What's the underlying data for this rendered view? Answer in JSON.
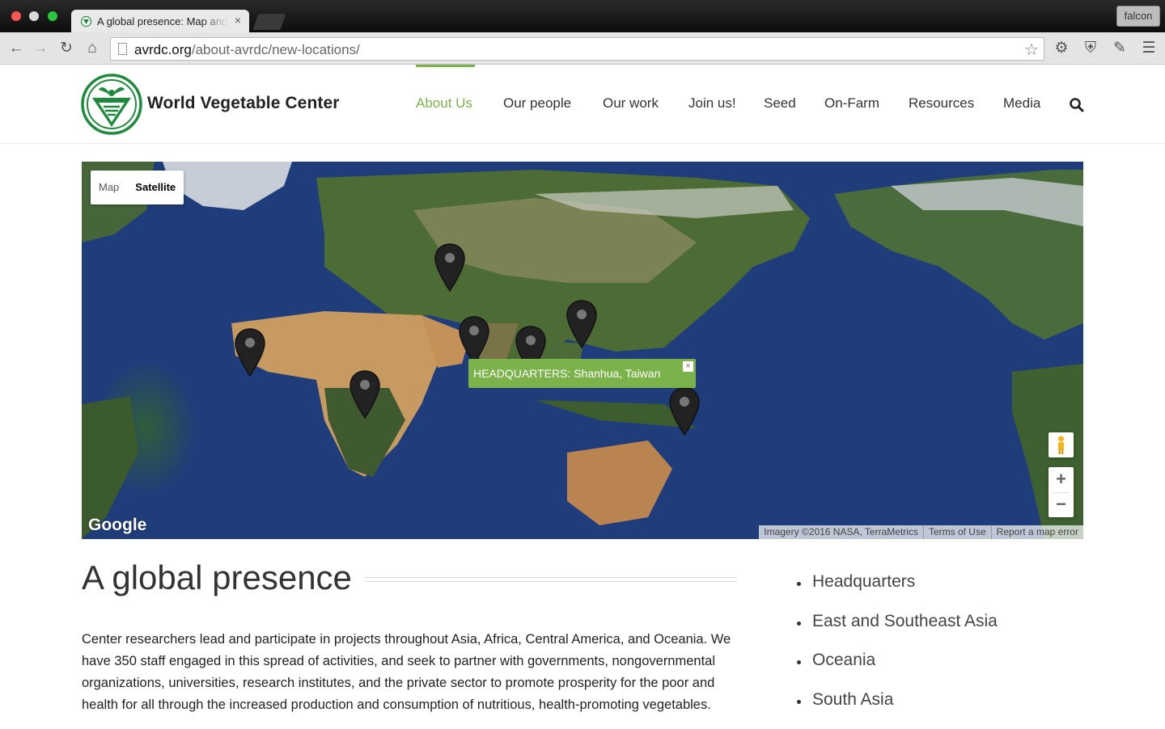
{
  "browser": {
    "tab_title": "A global presence: Map and",
    "tab_close": "×",
    "profile": "falcon",
    "url_host": "avrdc.org",
    "url_path": "/about-avrdc/new-locations/"
  },
  "site": {
    "logo_text": "World Vegetable Center",
    "nav": [
      {
        "label": "About Us",
        "active": true
      },
      {
        "label": "Our people"
      },
      {
        "label": "Our work"
      },
      {
        "label": "Join us!"
      },
      {
        "label": "Seed"
      },
      {
        "label": "On-Farm"
      },
      {
        "label": "Resources"
      },
      {
        "label": "Media"
      }
    ],
    "accent_color": "#7bb34a"
  },
  "map": {
    "type_map": "Map",
    "type_satellite": "Satellite",
    "selected_type": "Satellite",
    "infowindow": "HEADQUARTERS: Shanhua, Taiwan",
    "infowindow_close": "×",
    "zoom_in": "+",
    "zoom_out": "−",
    "logo": "Google",
    "attribution": {
      "imagery": "Imagery ©2016 NASA, TerraMetrics",
      "terms": "Terms of Use",
      "report": "Report a map error"
    },
    "marker_count": 8
  },
  "content": {
    "heading": "A global presence",
    "paragraph": "Center researchers lead and participate in projects throughout Asia, Africa, Central America, and Oceania. We have 350 staff engaged in this spread of activities, and seek to partner with governments, nongovernmental organizations, universities, research institutes, and the private sector to promote prosperity for the poor and health for all through the increased production and consumption of nutritious, health-promoting vegetables.",
    "regions": [
      "Headquarters",
      "East and Southeast Asia",
      "Oceania",
      "South Asia"
    ]
  }
}
